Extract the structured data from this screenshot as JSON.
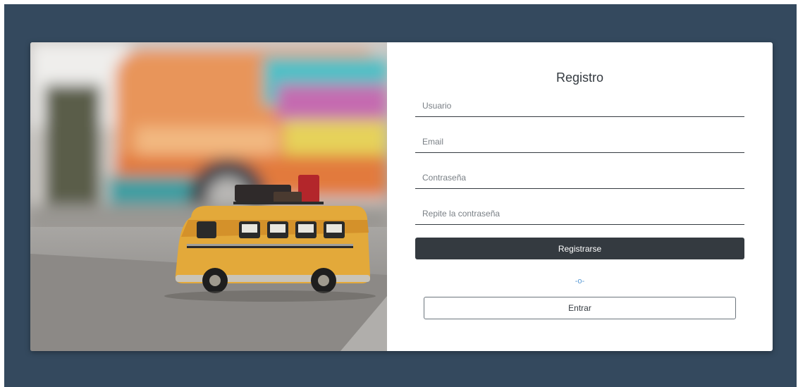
{
  "form": {
    "title": "Registro",
    "fields": [
      {
        "name": "usuario",
        "placeholder": "Usuario",
        "value": ""
      },
      {
        "name": "email",
        "placeholder": "Email",
        "value": ""
      },
      {
        "name": "password",
        "placeholder": "Contraseña",
        "value": ""
      },
      {
        "name": "password_repeat",
        "placeholder": "Repite la contraseña",
        "value": ""
      }
    ],
    "submit_label": "Registrarse",
    "separator": "-o-",
    "login_label": "Entrar"
  },
  "colors": {
    "background": "#34495e",
    "card": "#ffffff",
    "primary_button": "#343a40",
    "separator": "#5b9bd5"
  }
}
